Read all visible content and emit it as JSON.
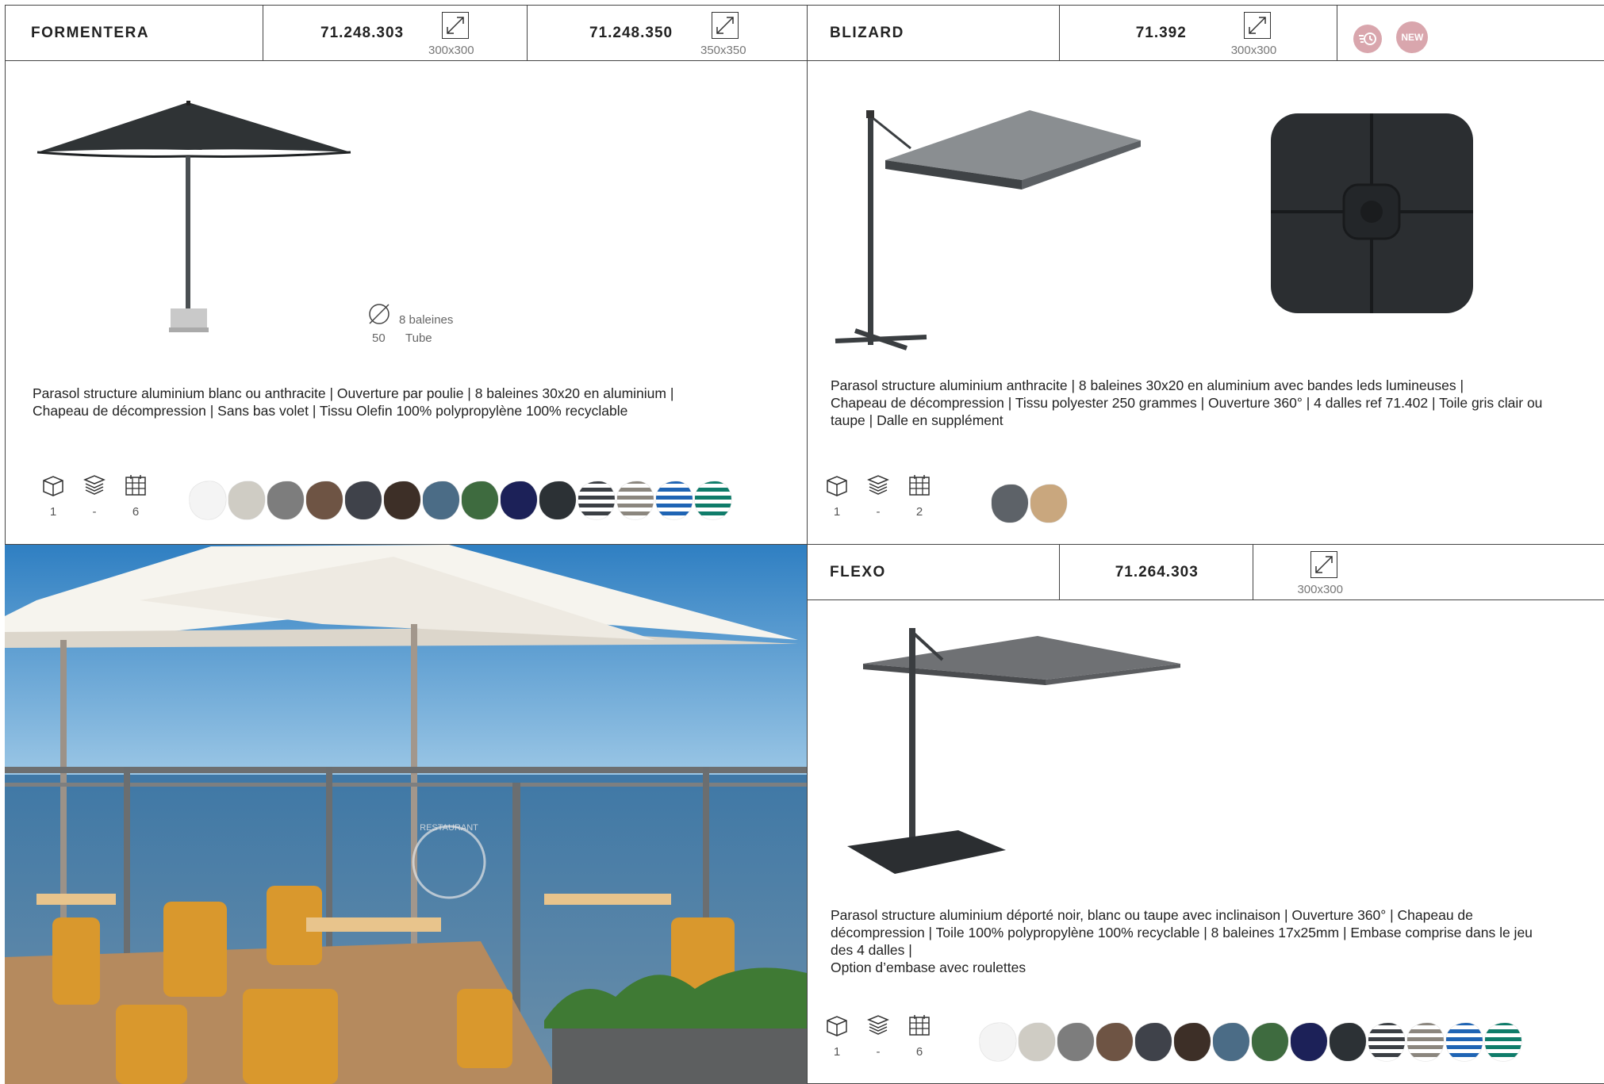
{
  "formentera": {
    "name": "FORMENTERA",
    "refs": [
      {
        "code": "71.248.303",
        "size": "300x300"
      },
      {
        "code": "71.248.350",
        "size": "350x350"
      }
    ],
    "tube_diameter": "50",
    "ribs": "8 baleines",
    "tube_label": "Tube",
    "description_l1": "Parasol structure aluminium blanc ou anthracite | Ouverture par poulie | 8 baleines 30x20 en aluminium |",
    "description_l2": "Chapeau de décompression | Sans bas volet | Tissu Olefin 100% polypropylène 100% recyclable",
    "packaging": {
      "carton": "1",
      "stack": "-",
      "pallet": "6"
    },
    "swatches": [
      "#f4f4f4",
      "#cfccc4",
      "#7d7d7d",
      "#6e5444",
      "#3f424a",
      "#3d2f27",
      "#4b6c86",
      "#3e6b3f",
      "#1c2158",
      "#2c3135",
      "stripe-grey",
      "stripe-taupe",
      "stripe-blue",
      "stripe-green"
    ]
  },
  "blizard": {
    "name": "BLIZARD",
    "ref": {
      "code": "71.392",
      "size": "300x300"
    },
    "badges": [
      "clock-icon",
      "NEW"
    ],
    "description_l1": "Parasol structure aluminium anthracite | 8 baleines 30x20 en aluminium avec bandes leds lumineuses |",
    "description_l2": "Chapeau de décompression | Tissu polyester 250 grammes | Ouverture 360° | 4 dalles ref 71.402 | Toile gris clair ou",
    "description_l3": "taupe | Dalle en supplément",
    "packaging": {
      "carton": "1",
      "stack": "-",
      "pallet": "2"
    },
    "swatches": [
      "#5d6268",
      "#c9a77e"
    ]
  },
  "flexo": {
    "name": "FLEXO",
    "ref": {
      "code": "71.264.303",
      "size": "300x300"
    },
    "description_l1": "Parasol structure aluminium déporté noir, blanc ou taupe avec inclinaison | Ouverture 360° | Chapeau de",
    "description_l2": "décompression | Toile 100% polypropylène 100% recyclable  | 8 baleines 17x25mm | Embase comprise dans le jeu",
    "description_l3": "des 4 dalles |",
    "description_l4": "Option d’embase avec roulettes",
    "packaging": {
      "carton": "1",
      "stack": "-",
      "pallet": "6"
    },
    "swatches": [
      "#f4f4f4",
      "#cfccc4",
      "#7d7d7d",
      "#6e5444",
      "#3f424a",
      "#3d2f27",
      "#4b6c86",
      "#3e6b3f",
      "#1c2158",
      "#2c3135",
      "stripe-grey",
      "stripe-taupe",
      "stripe-blue",
      "stripe-green"
    ]
  },
  "photo": {
    "panel_text": "RESTAURANT"
  }
}
